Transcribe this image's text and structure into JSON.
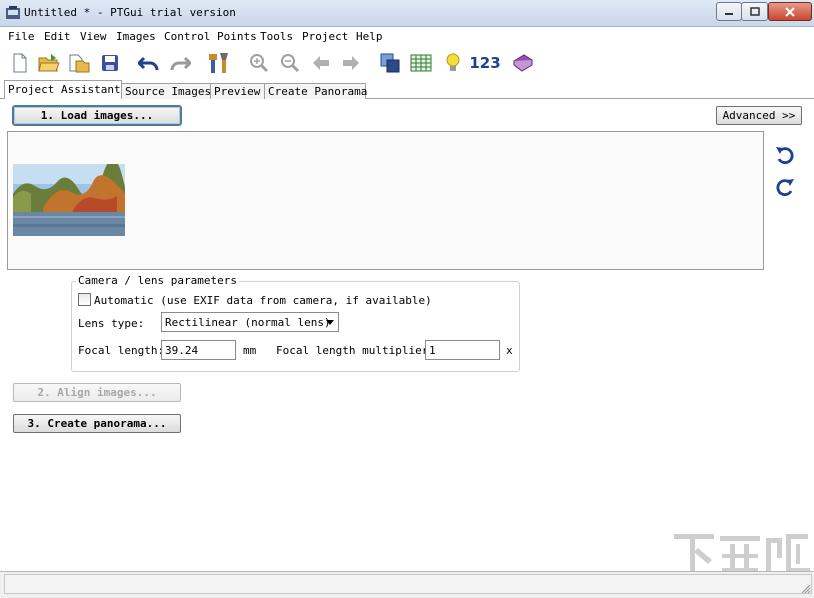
{
  "window": {
    "title": "Untitled * - PTGui trial version"
  },
  "menu": [
    "File",
    "Edit",
    "View",
    "Images",
    "Control Points",
    "Tools",
    "Project",
    "Help"
  ],
  "toolbar": {
    "numbers_label": "123",
    "icons": [
      "new-document-icon",
      "open-folder-icon",
      "open-recent-icon",
      "save-icon",
      "undo-icon",
      "redo-icon",
      "tools-icon",
      "zoom-in-icon",
      "zoom-out-icon",
      "back-arrow-icon",
      "forward-arrow-icon",
      "layers-icon",
      "table-icon",
      "lightbulb-icon",
      "numbers-icon",
      "help-book-icon"
    ]
  },
  "tabs": [
    "Project Assistant",
    "Source Images",
    "Preview",
    "Create Panorama"
  ],
  "active_tab": "Project Assistant",
  "buttons": {
    "load": "1. Load images...",
    "advanced": "Advanced >>",
    "align": "2. Align images...",
    "create": "3. Create panorama..."
  },
  "camera": {
    "legend": "Camera / lens parameters",
    "automatic_label": "Automatic (use EXIF data from camera, if available)",
    "automatic_checked": false,
    "lens_type_label": "Lens type:",
    "lens_type_value": "Rectilinear (normal lens)",
    "focal_length_label": "Focal length:",
    "focal_length_value": "39.24",
    "focal_unit": "mm",
    "multiplier_label": "Focal length multiplier:",
    "multiplier_value": "1",
    "multiplier_unit": "x"
  },
  "watermark": "下载吧",
  "colors": {
    "accent": "#1f3f8f",
    "titlebar": "#c9d7e9",
    "close": "#c8462f"
  }
}
